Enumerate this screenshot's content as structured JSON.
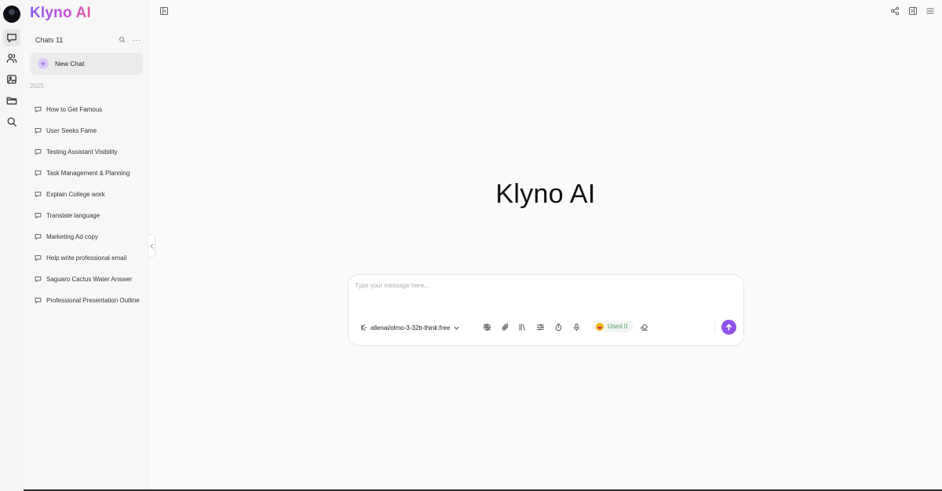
{
  "app": {
    "brand": "Klyno AI",
    "hero_title": "Klyno AI"
  },
  "rail": {
    "items": [
      {
        "id": "chats",
        "icon": "chat-icon",
        "active": true
      },
      {
        "id": "people",
        "icon": "users-icon",
        "active": false
      },
      {
        "id": "images",
        "icon": "image-icon",
        "active": false
      },
      {
        "id": "files",
        "icon": "folder-icon",
        "active": false
      },
      {
        "id": "search",
        "icon": "search-icon",
        "active": false
      }
    ]
  },
  "sidebar": {
    "chats_label": "Chats 11",
    "new_chat_label": "New Chat",
    "group_label": "2025",
    "chats": [
      {
        "title": "How to Get Famous"
      },
      {
        "title": "User Seeks Fame"
      },
      {
        "title": "Testing Assistant Visibility"
      },
      {
        "title": "Task Management & Planning"
      },
      {
        "title": "Explain College work"
      },
      {
        "title": "Translate language"
      },
      {
        "title": "Marketing Ad copy"
      },
      {
        "title": "Help write professional email"
      },
      {
        "title": "Saguaro Cactus Water Answer"
      },
      {
        "title": "Professional Presentation Outline"
      }
    ]
  },
  "composer": {
    "placeholder": "Type your message here...",
    "value": "",
    "model": "allenai/olmo-3-32b-think:free",
    "used_label": "Used 0",
    "tools": [
      "web-off-icon",
      "paperclip-icon",
      "library-icon",
      "sliders-icon",
      "timer-icon",
      "microphone-icon"
    ]
  },
  "colors": {
    "accent": "#8e54e9",
    "brand_gradient_start": "#8a5cf6",
    "brand_gradient_end": "#e35aa8",
    "used_text": "#4f9a64"
  }
}
